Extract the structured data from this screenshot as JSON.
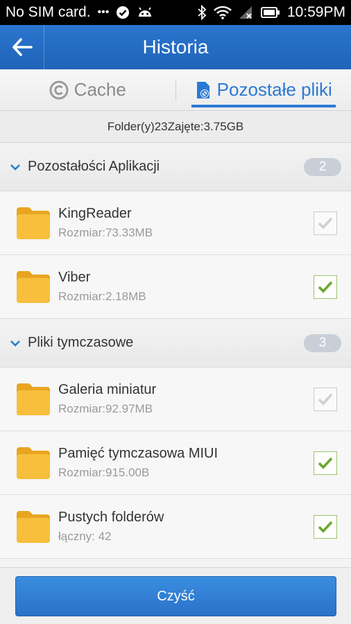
{
  "status_bar": {
    "carrier": "No SIM card.",
    "dots": "•••",
    "time": "10:59PM",
    "icons": [
      "check-circle-icon",
      "android-icon",
      "bluetooth-icon",
      "wifi-icon",
      "signal-icon",
      "battery-icon"
    ]
  },
  "app_bar": {
    "title": "Historia",
    "back_icon": "arrow-left-icon"
  },
  "tabs": [
    {
      "label": "Cache",
      "icon": "copyright-icon",
      "active": false
    },
    {
      "label": "Pozostałe pliki",
      "icon": "file-block-icon",
      "active": true
    }
  ],
  "summary": "Folder(y)23Zajęte:3.75GB",
  "groups": [
    {
      "label": "Pozostałości Aplikacji",
      "count": "2",
      "items": [
        {
          "name": "KingReader",
          "sub": "Rozmiar:73.33MB",
          "checked": false
        },
        {
          "name": "Viber",
          "sub": "Rozmiar:2.18MB",
          "checked": true
        }
      ]
    },
    {
      "label": "Pliki tymczasowe",
      "count": "3",
      "items": [
        {
          "name": "Galeria miniatur",
          "sub": "Rozmiar:92.97MB",
          "checked": false
        },
        {
          "name": "Pamięć tymczasowa MIUI",
          "sub": "Rozmiar:915.00B",
          "checked": true
        },
        {
          "name": "Pustych folderów",
          "sub": "łączny: 42",
          "checked": true
        }
      ]
    }
  ],
  "footer": {
    "clean_label": "Czyść"
  },
  "colors": {
    "accent": "#2a7ad3",
    "appbar": "#2169c0",
    "check_green": "#6aa72f",
    "folder": "#f6b931"
  }
}
